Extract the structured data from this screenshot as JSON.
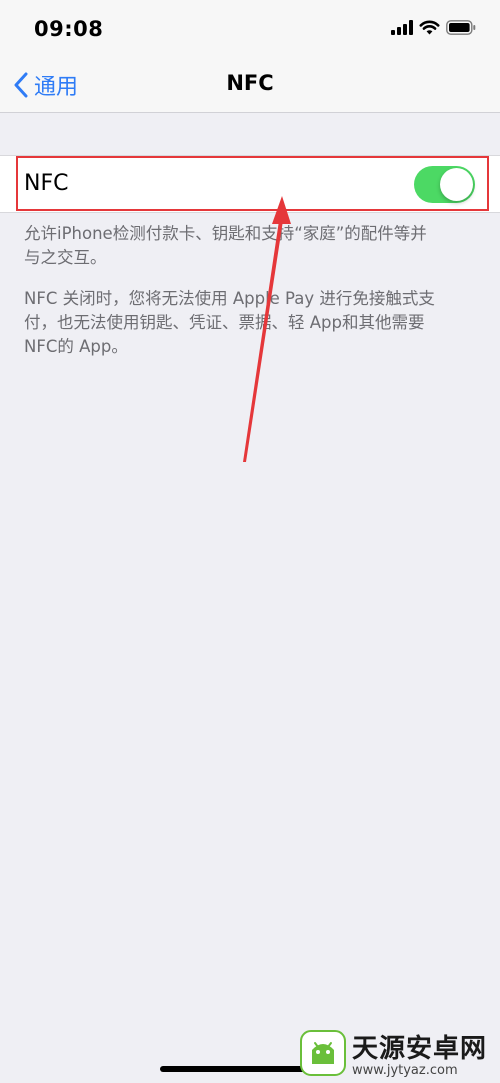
{
  "status_bar": {
    "time": "09:08"
  },
  "nav": {
    "back_label": "通用",
    "title": "NFC"
  },
  "nfc_cell": {
    "label": "NFC",
    "toggle_on": true,
    "toggle_color": "#4cd964"
  },
  "footer": {
    "line1": "允许iPhone检测付款卡、钥匙和支持“家庭”的配件等并",
    "line2": "与之交互。",
    "line3": "NFC 关闭时，您将无法使用 Apple Pay 进行免接触式支",
    "line4": "付，也无法使用钥匙、凭证、票据、轻 App和其他需要",
    "line5": "NFC的 App。"
  },
  "watermark": {
    "title": "天源安卓网",
    "url": "www.jytyaz.com"
  },
  "colors": {
    "accent": "#2f7cf6",
    "annotation": "#e5373a",
    "background": "#efeff4"
  }
}
